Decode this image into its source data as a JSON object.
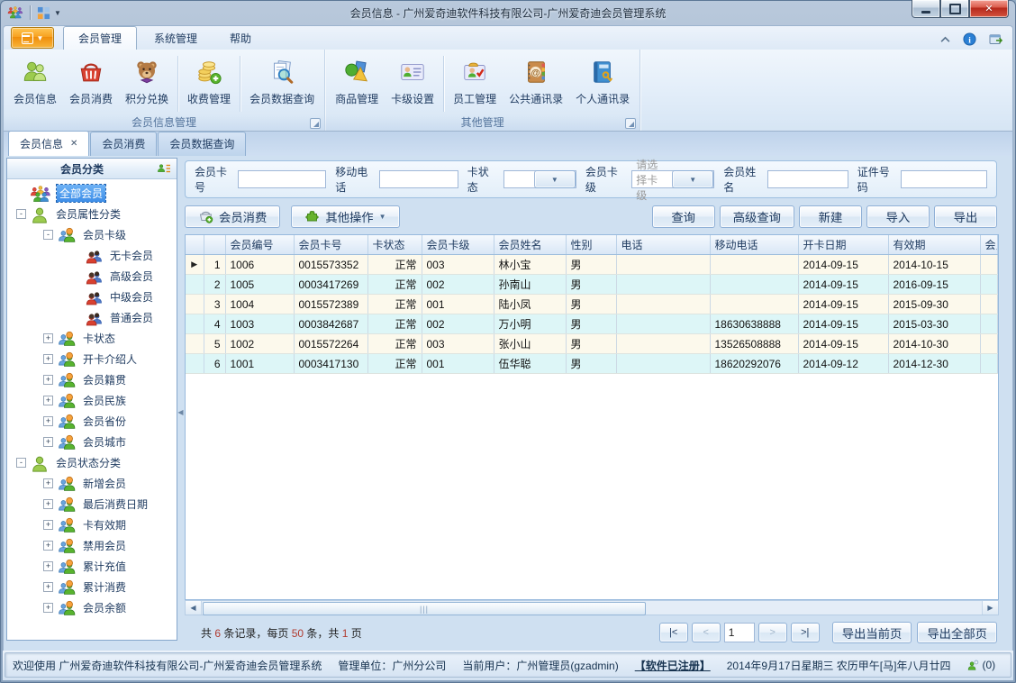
{
  "colors": {
    "accent_orange": "#f7a120",
    "link_blue": "#0b5fd0",
    "row_odd": "#fcf9ec",
    "row_even": "#ddf6f7",
    "tree_selected": "#3d8ee8",
    "summary_number": "#b03a2e",
    "close_red": "#c23b2b"
  },
  "window": {
    "title": "会员信息 - 广州爱奇迪软件科技有限公司-广州爱奇迪会员管理系统",
    "quick_access": [
      "app-logo-icon",
      "window-grid-icon"
    ],
    "controls": [
      {
        "name": "minimize-button"
      },
      {
        "name": "maximize-button"
      },
      {
        "name": "close-button",
        "glyph": "X"
      }
    ]
  },
  "menu_tabs": [
    {
      "name": "member-management",
      "label": "会员管理",
      "active": true
    },
    {
      "name": "system-management",
      "label": "系统管理",
      "active": false
    },
    {
      "name": "help",
      "label": "帮助",
      "active": false
    }
  ],
  "tabrow_icons": [
    "collapse-ribbon-icon",
    "info-icon",
    "feedback-icon"
  ],
  "ribbon": {
    "groups": [
      {
        "label": "会员信息管理",
        "items": [
          {
            "name": "member-info",
            "label": "会员信息",
            "icon": "members-icon"
          },
          {
            "name": "member-consume",
            "label": "会员消费",
            "icon": "basket-icon"
          },
          {
            "name": "points-exchange",
            "label": "积分兑换",
            "icon": "teddy-bear-icon",
            "sep_after": true
          },
          {
            "name": "fee-management",
            "label": "收费管理",
            "icon": "coins-icon",
            "sep_after": true
          },
          {
            "name": "member-data-query",
            "label": "会员数据查询",
            "icon": "member-query-icon"
          }
        ]
      },
      {
        "label": "其他管理",
        "items": [
          {
            "name": "goods-management",
            "label": "商品管理",
            "icon": "goods-icon"
          },
          {
            "name": "card-level-settings",
            "label": "卡级设置",
            "icon": "card-level-icon",
            "sep_after": true
          },
          {
            "name": "staff-management",
            "label": "员工管理",
            "icon": "staff-icon"
          },
          {
            "name": "public-contacts",
            "label": "公共通讯录",
            "icon": "public-contacts-icon"
          },
          {
            "name": "personal-contacts",
            "label": "个人通讯录",
            "icon": "personal-contacts-icon"
          }
        ]
      }
    ]
  },
  "doc_tabs": [
    {
      "name": "member-info-tab",
      "label": "会员信息",
      "active": true,
      "closable": true
    },
    {
      "name": "member-consume-tab",
      "label": "会员消费",
      "active": false
    },
    {
      "name": "member-data-query-tab",
      "label": "会员数据查询",
      "active": false
    }
  ],
  "sidebar": {
    "header": "会员分类",
    "header_icon": "member-list-icon",
    "tree": [
      {
        "name": "all-members",
        "label": "全部会员",
        "level": 0,
        "expander": "",
        "icon": "all-members-icon",
        "selected": true
      },
      {
        "name": "member-attribute-category",
        "label": "会员属性分类",
        "level": 0,
        "expander": "-",
        "icon": "category-person-icon"
      },
      {
        "name": "member-card-level",
        "label": "会员卡级",
        "level": 1,
        "expander": "-",
        "icon": "subcategory-icon"
      },
      {
        "name": "no-card-member",
        "label": "无卡会员",
        "level": 2,
        "expander": "",
        "icon": "member-leaf-icon"
      },
      {
        "name": "senior-member",
        "label": "高级会员",
        "level": 2,
        "expander": "",
        "icon": "member-leaf-icon"
      },
      {
        "name": "middle-member",
        "label": "中级会员",
        "level": 2,
        "expander": "",
        "icon": "member-leaf-icon"
      },
      {
        "name": "normal-member",
        "label": "普通会员",
        "level": 2,
        "expander": "",
        "icon": "member-leaf-icon"
      },
      {
        "name": "card-status",
        "label": "卡状态",
        "level": 1,
        "expander": "+",
        "icon": "subcategory-icon"
      },
      {
        "name": "card-introducer",
        "label": "开卡介绍人",
        "level": 1,
        "expander": "+",
        "icon": "subcategory-icon"
      },
      {
        "name": "member-birthplace",
        "label": "会员籍贯",
        "level": 1,
        "expander": "+",
        "icon": "subcategory-icon"
      },
      {
        "name": "member-ethnicity",
        "label": "会员民族",
        "level": 1,
        "expander": "+",
        "icon": "subcategory-icon"
      },
      {
        "name": "member-province",
        "label": "会员省份",
        "level": 1,
        "expander": "+",
        "icon": "subcategory-icon"
      },
      {
        "name": "member-city",
        "label": "会员城市",
        "level": 1,
        "expander": "+",
        "icon": "subcategory-icon"
      },
      {
        "name": "member-status-category",
        "label": "会员状态分类",
        "level": 0,
        "expander": "-",
        "icon": "category-person-icon"
      },
      {
        "name": "new-members",
        "label": "新增会员",
        "level": 1,
        "expander": "+",
        "icon": "subcategory-icon"
      },
      {
        "name": "last-consume-date",
        "label": "最后消费日期",
        "level": 1,
        "expander": "+",
        "icon": "subcategory-icon"
      },
      {
        "name": "card-validity",
        "label": "卡有效期",
        "level": 1,
        "expander": "+",
        "icon": "subcategory-icon"
      },
      {
        "name": "disabled-members",
        "label": "禁用会员",
        "level": 1,
        "expander": "+",
        "icon": "subcategory-icon"
      },
      {
        "name": "total-recharge",
        "label": "累计充值",
        "level": 1,
        "expander": "+",
        "icon": "subcategory-icon"
      },
      {
        "name": "total-consume",
        "label": "累计消费",
        "level": 1,
        "expander": "+",
        "icon": "subcategory-icon"
      },
      {
        "name": "member-balance",
        "label": "会员余额",
        "level": 1,
        "expander": "+",
        "icon": "subcategory-icon"
      }
    ]
  },
  "filters": [
    {
      "name": "member-card-no",
      "label": "会员卡号",
      "type": "input",
      "value": ""
    },
    {
      "name": "mobile-phone",
      "label": "移动电话",
      "type": "input",
      "value": ""
    },
    {
      "name": "card-status",
      "label": "卡状态",
      "type": "combo",
      "value": ""
    },
    {
      "name": "member-card-level",
      "label": "会员卡级",
      "type": "combo",
      "value": "请选择卡级"
    },
    {
      "name": "member-name",
      "label": "会员姓名",
      "type": "input",
      "value": ""
    },
    {
      "name": "id-number",
      "label": "证件号码",
      "type": "input",
      "value": ""
    }
  ],
  "toolbar": {
    "left": [
      {
        "name": "member-consume-button",
        "label": "会员消费",
        "icon": "consume-basket-icon"
      },
      {
        "name": "other-operations-button",
        "label": "其他操作",
        "icon": "puzzle-icon",
        "dropdown": true
      }
    ],
    "right": [
      {
        "name": "query-button",
        "label": "查询"
      },
      {
        "name": "advanced-query-button",
        "label": "高级查询"
      },
      {
        "name": "new-button",
        "label": "新建"
      },
      {
        "name": "import-button",
        "label": "导入"
      },
      {
        "name": "export-button",
        "label": "导出"
      }
    ]
  },
  "grid": {
    "columns": [
      "会员编号",
      "会员卡号",
      "卡状态",
      "会员卡级",
      "会员姓名",
      "性别",
      "电话",
      "移动电话",
      "开卡日期",
      "有效期",
      "会员"
    ],
    "rows": [
      [
        "1006",
        "0015573352",
        "正常",
        "003",
        "林小宝",
        "男",
        "",
        "",
        "2014-09-15",
        "2014-10-15",
        ""
      ],
      [
        "1005",
        "0003417269",
        "正常",
        "002",
        "孙南山",
        "男",
        "",
        "",
        "2014-09-15",
        "2016-09-15",
        ""
      ],
      [
        "1004",
        "0015572389",
        "正常",
        "001",
        "陆小凤",
        "男",
        "",
        "",
        "2014-09-15",
        "2015-09-30",
        ""
      ],
      [
        "1003",
        "0003842687",
        "正常",
        "002",
        "万小明",
        "男",
        "",
        "18630638888",
        "2014-09-15",
        "2015-03-30",
        ""
      ],
      [
        "1002",
        "0015572264",
        "正常",
        "003",
        "张小山",
        "男",
        "",
        "13526508888",
        "2014-09-15",
        "2014-10-30",
        ""
      ],
      [
        "1001",
        "0003417130",
        "正常",
        "001",
        "伍华聪",
        "男",
        "",
        "18620292076",
        "2014-09-12",
        "2014-12-30",
        ""
      ]
    ],
    "active_row_index": 0
  },
  "pager": {
    "summary": [
      {
        "t": "共 "
      },
      {
        "t": "6",
        "num": true
      },
      {
        "t": " 条记录，每页 "
      },
      {
        "t": "50",
        "num": true
      },
      {
        "t": " 条，共 "
      },
      {
        "t": "1",
        "num": true
      },
      {
        "t": " 页"
      }
    ],
    "nav": [
      {
        "name": "first-page-button",
        "label": "|<",
        "enabled": true
      },
      {
        "name": "prev-page-button",
        "label": "<",
        "enabled": false
      },
      {
        "name": "page-input",
        "type": "input",
        "value": "1"
      },
      {
        "name": "next-page-button",
        "label": ">",
        "enabled": false
      },
      {
        "name": "last-page-button",
        "label": ">|",
        "enabled": true
      }
    ],
    "export_current": "导出当前页",
    "export_all": "导出全部页"
  },
  "status_bar": {
    "welcome": "欢迎使用 广州爱奇迪软件科技有限公司-广州爱奇迪会员管理系统",
    "unit": "管理单位：广州分公司",
    "user": "当前用户：广州管理员(gzadmin)",
    "register_link": "【软件已注册】",
    "datetime": "2014年9月17日星期三 农历甲午[马]年八月廿四",
    "online_count": "(0)"
  }
}
